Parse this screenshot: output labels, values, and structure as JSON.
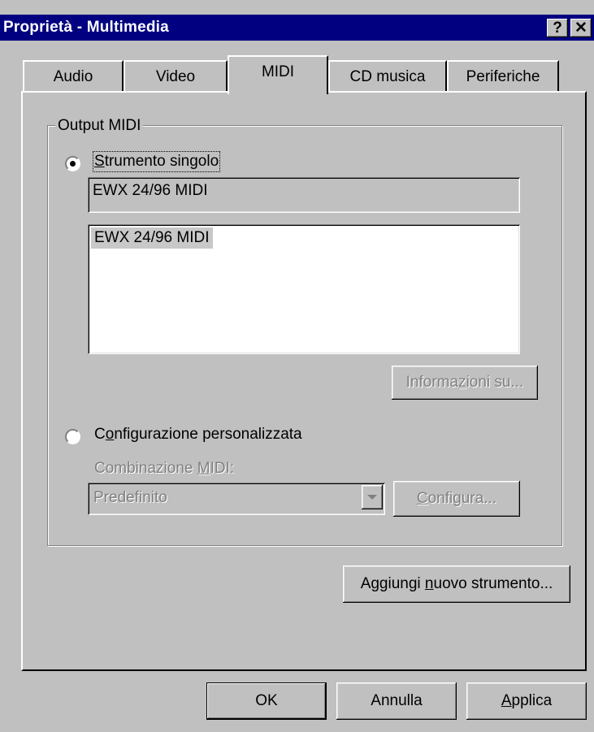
{
  "window": {
    "title": "Proprietà - Multimedia",
    "help_button": "?",
    "close_button": "✕"
  },
  "tabs": [
    {
      "label": "Audio",
      "active": false
    },
    {
      "label": "Video",
      "active": false
    },
    {
      "label": "MIDI",
      "active": true
    },
    {
      "label": "CD musica",
      "active": false
    },
    {
      "label": "Periferiche",
      "active": false
    }
  ],
  "output_midi": {
    "group_label": "Output MIDI",
    "single_instrument": {
      "label_u": "S",
      "label_rest": "trumento singolo",
      "selected": true,
      "current_value": "EWX 24/96 MIDI",
      "list_items": [
        "EWX 24/96 MIDI"
      ],
      "info_button_pre": "Informa",
      "info_button_u": "z",
      "info_button_post": "ioni su..."
    },
    "custom_config": {
      "label_pre": "C",
      "label_u": "o",
      "label_post": "nfigurazione personalizzata",
      "selected": false,
      "combo_label_pre": "Combinazione ",
      "combo_label_u": "M",
      "combo_label_post": "IDI:",
      "combo_value": "Predefinito",
      "configure_u": "C",
      "configure_post": "onfigura..."
    }
  },
  "add_instrument_button": {
    "pre": "Aggiungi ",
    "u": "n",
    "post": "uovo strumento..."
  },
  "footer": {
    "ok": "OK",
    "cancel": "Annulla",
    "apply_u": "A",
    "apply_post": "pplica"
  },
  "colors": {
    "title_bar": "#000080",
    "face": "#c0c0c0",
    "disabled_text": "#808080"
  }
}
